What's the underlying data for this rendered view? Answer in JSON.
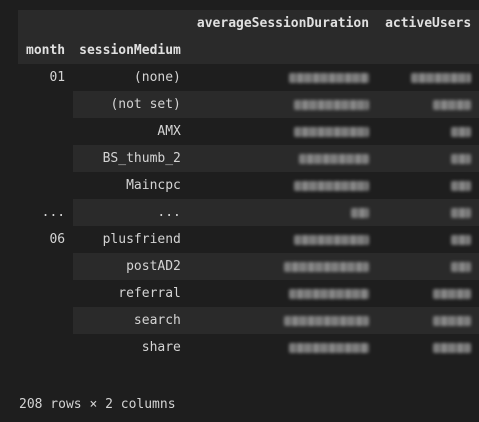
{
  "table": {
    "index_header_1": "",
    "index_header_2": [
      "month",
      "sessionMedium"
    ],
    "columns": [
      "averageSessionDuration",
      "activeUsers"
    ],
    "rows": [
      {
        "month": "01",
        "medium": "(none)"
      },
      {
        "month": "",
        "medium": "(not set)"
      },
      {
        "month": "",
        "medium": "AMX"
      },
      {
        "month": "",
        "medium": "BS_thumb_2"
      },
      {
        "month": "",
        "medium": "Maincpc"
      },
      {
        "month": "...",
        "medium": "..."
      },
      {
        "month": "06",
        "medium": "plusfriend"
      },
      {
        "month": "",
        "medium": "postAD2"
      },
      {
        "month": "",
        "medium": "referral"
      },
      {
        "month": "",
        "medium": "search"
      },
      {
        "month": "",
        "medium": "share"
      }
    ]
  },
  "footer": {
    "summary": "208 rows × 2 columns"
  }
}
